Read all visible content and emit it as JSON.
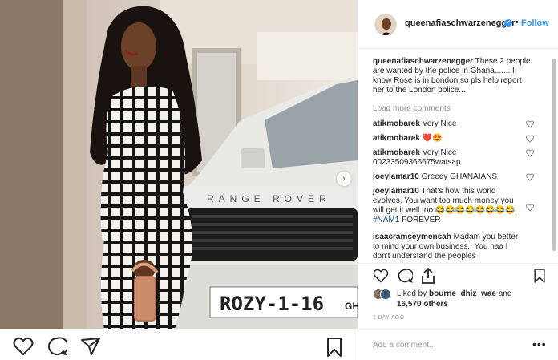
{
  "post": {
    "username": "queenafiaschwarzenegger",
    "verified_mark": "✓",
    "dot": "•",
    "follow_label": "Follow",
    "caption_text": "These 2 people are wanted by the police in Ghana....... I know Rose is in London so pls help report her to the London police...",
    "load_more_label": "Load more comments",
    "plate_text": "ROZY-1-16",
    "plate_suffix": "GH",
    "car_badge": "RANGE ROVER"
  },
  "comments": [
    {
      "username": "atikmobarek",
      "text": "Very Nice",
      "emoji": ""
    },
    {
      "username": "atikmobarek",
      "text": "",
      "emoji": "❤️😍"
    },
    {
      "username": "atikmobarek",
      "text": "Very Nice 00233509366675watsap",
      "emoji": ""
    },
    {
      "username": "joeylamar10",
      "text": "Greedy GHANAIANS",
      "emoji": ""
    },
    {
      "username": "joeylamar10",
      "text": "That's how this world evolves. You want too much money you will get it well too",
      "emoji": "😂😂😂😂😂😂😂😂.",
      "tag": "#NAM1",
      "tail": "FOREVER"
    },
    {
      "username": "isaacramseymensah",
      "text": "Madam you better to mind your own business.. You naa I don't understand the peoples",
      "emoji": ""
    }
  ],
  "likes": {
    "prefix": "Liked by",
    "user": "bourne_dhiz_wae",
    "joiner": "and",
    "count_text": "16,570 others"
  },
  "timestamp": "1 DAY AGO",
  "comment_box": {
    "placeholder": "Add a comment...",
    "more_label": "•••"
  },
  "icons": {
    "heart": "heart-icon",
    "comment": "comment-icon",
    "share": "share-icon",
    "save": "bookmark-icon",
    "next": "chevron-right-icon"
  },
  "colors": {
    "accent": "#3897f0",
    "muted": "#8e8e8e",
    "text": "#262626"
  }
}
